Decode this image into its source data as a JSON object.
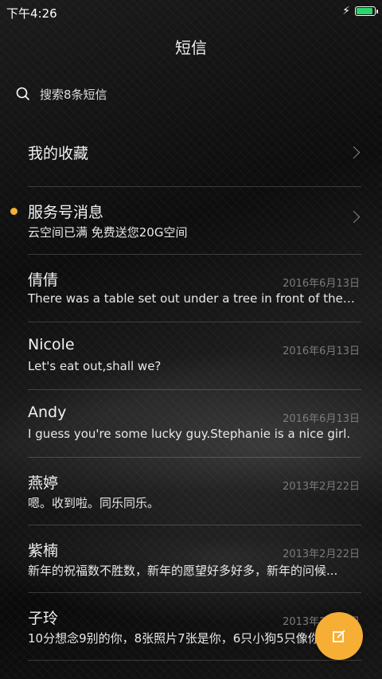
{
  "status_bar": {
    "time": "下午4:26"
  },
  "header": {
    "title": "短信"
  },
  "search": {
    "placeholder": "搜索8条短信"
  },
  "items": [
    {
      "name": "我的收藏",
      "preview": "",
      "date": "",
      "chevron": true
    },
    {
      "name": "服务号消息",
      "preview": "云空间已满 免费送您20G空间",
      "date": "",
      "chevron": true,
      "unread": true
    },
    {
      "name": "倩倩",
      "preview": "There was a table set out under a tree in front of the ho...",
      "date": "2016年6月13日"
    },
    {
      "name": "Nicole",
      "preview": "Let's eat out,shall we?",
      "date": "2016年6月13日"
    },
    {
      "name": "Andy",
      "preview": "I guess you're some lucky guy.Stephanie is a nice girl.",
      "date": "2016年6月13日"
    },
    {
      "name": "燕婷",
      "preview": "嗯。收到啦。同乐同乐。",
      "date": "2013年2月22日"
    },
    {
      "name": "紫楠",
      "preview": "新年的祝福数不胜数，新年的愿望好多好多，新年的问候...",
      "date": "2013年2月22日"
    },
    {
      "name": "子玲",
      "preview": "10分想念9别的你，8张照片7张是你，6只小狗5只像你",
      "date": "2013年2月22日"
    }
  ],
  "colors": {
    "accent": "#f6ae35",
    "unread_dot": "#f3b234",
    "battery": "#2bd56b"
  },
  "icons": {
    "search": "search-icon",
    "compose": "compose-icon",
    "chevron": "chevron-right-icon",
    "charging": "bolt-icon"
  }
}
